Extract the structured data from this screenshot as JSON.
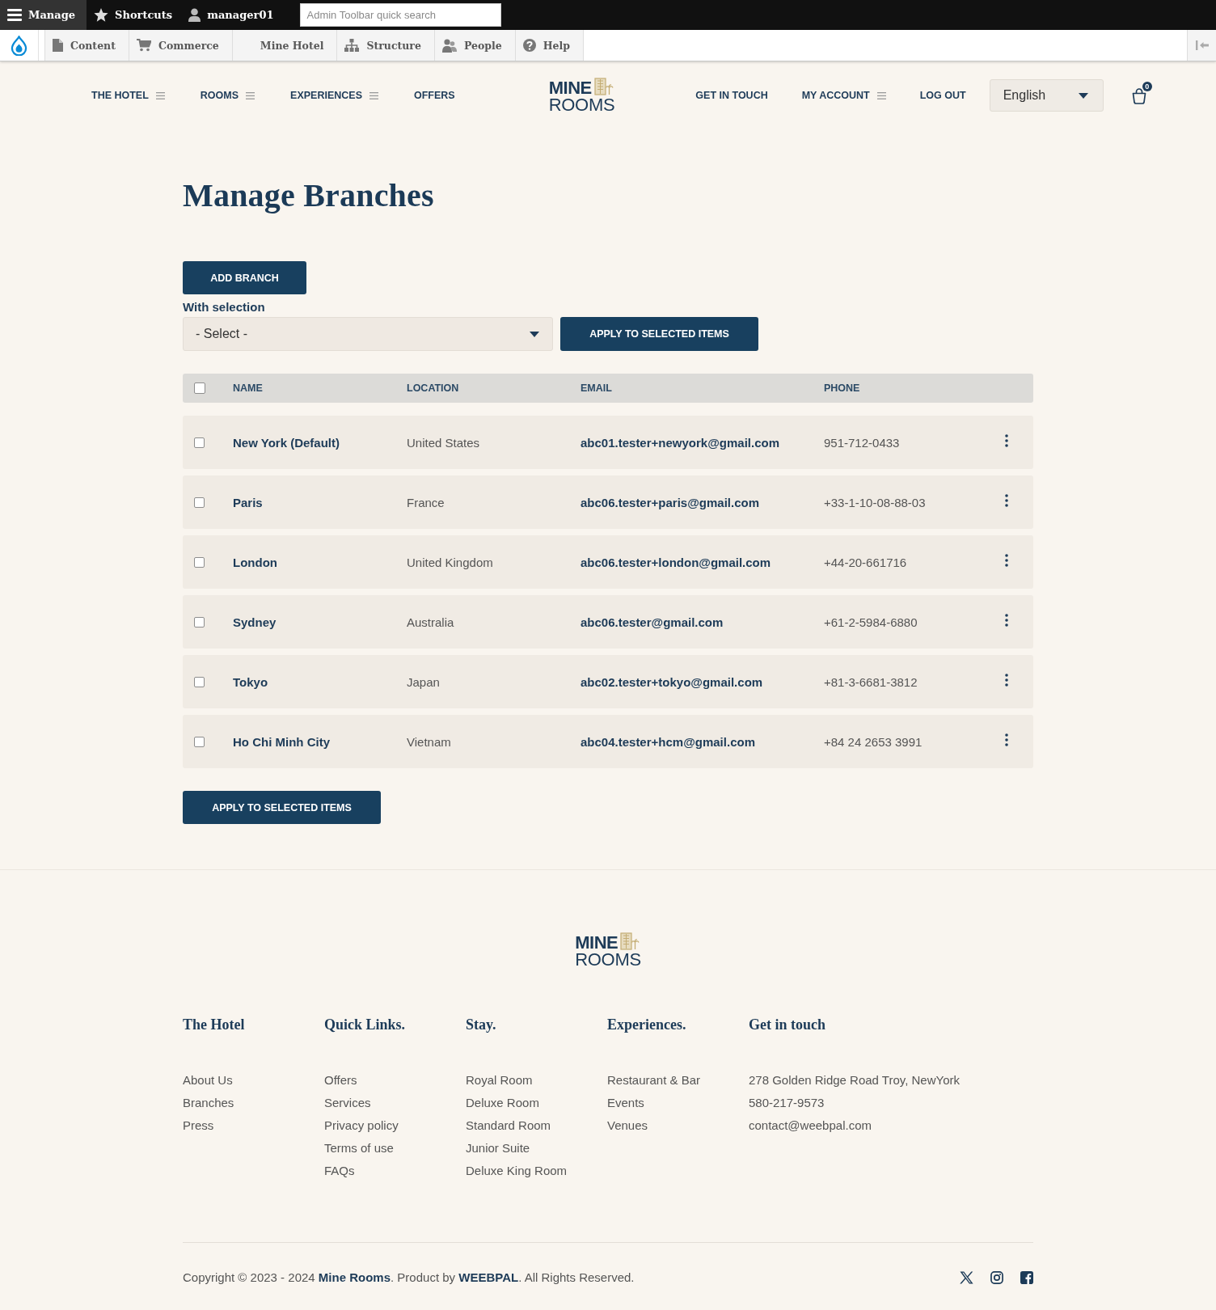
{
  "admin_bar": {
    "items": [
      {
        "label": "Manage",
        "selected": true
      },
      {
        "label": "Shortcuts",
        "selected": false
      },
      {
        "label": "manager01",
        "selected": false
      }
    ],
    "search": {
      "placeholder": "Admin Toolbar quick search"
    }
  },
  "admin_menu": {
    "items": [
      {
        "label": "Content"
      },
      {
        "label": "Commerce"
      },
      {
        "label": "Mine Hotel"
      },
      {
        "label": "Structure"
      },
      {
        "label": "People"
      },
      {
        "label": "Help"
      }
    ]
  },
  "header": {
    "nav_left": [
      {
        "label": "THE HOTEL",
        "submenu": true
      },
      {
        "label": "ROOMS",
        "submenu": true
      },
      {
        "label": "EXPERIENCES",
        "submenu": true
      },
      {
        "label": "OFFERS",
        "submenu": false
      }
    ],
    "logo": {
      "line_1": "MINE",
      "line_2": "ROOMS"
    },
    "nav_right": [
      {
        "label": "GET IN TOUCH",
        "submenu": false
      },
      {
        "label": "MY ACCOUNT",
        "submenu": true
      },
      {
        "label": "LOG OUT",
        "submenu": false
      }
    ],
    "language": {
      "value": "English"
    },
    "cart": {
      "count": "0"
    }
  },
  "page": {
    "title": "Manage Branches",
    "add_button": "ADD BRANCH",
    "bulk": {
      "label": "With selection",
      "select_value": "- Select -",
      "apply_button": "APPLY TO SELECTED ITEMS"
    }
  },
  "table": {
    "select_all": {
      "checked": false
    },
    "columns": [
      "NAME",
      "LOCATION",
      "EMAIL",
      "PHONE"
    ],
    "rows": [
      {
        "name": "New York (Default)",
        "location": "United States",
        "email": "abc01.tester+newyork@gmail.com",
        "phone": "951-712-0433",
        "checked": false
      },
      {
        "name": "Paris",
        "location": "France",
        "email": "abc06.tester+paris@gmail.com",
        "phone": "+33-1-10-08-88-03",
        "checked": false
      },
      {
        "name": "London",
        "location": "United Kingdom",
        "email": "abc06.tester+london@gmail.com",
        "phone": "+44-20-661716",
        "checked": false
      },
      {
        "name": "Sydney",
        "location": "Australia",
        "email": "abc06.tester@gmail.com",
        "phone": "+61-2-5984-6880",
        "checked": false
      },
      {
        "name": "Tokyo",
        "location": "Japan",
        "email": "abc02.tester+tokyo@gmail.com",
        "phone": "+81-3-6681-3812",
        "checked": false
      },
      {
        "name": "Ho Chi Minh City",
        "location": "Vietnam",
        "email": "abc04.tester+hcm@gmail.com",
        "phone": "+84 24 2653 3991",
        "checked": false
      }
    ]
  },
  "bottom_apply_button": "APPLY TO SELECTED ITEMS",
  "footer": {
    "logo": {
      "line_1": "MINE",
      "line_2": "ROOMS"
    },
    "columns": [
      {
        "title": "The Hotel",
        "items": [
          "About Us",
          "Branches",
          "Press"
        ]
      },
      {
        "title": "Quick Links.",
        "items": [
          "Offers",
          "Services",
          "Privacy policy",
          "Terms of use",
          "FAQs"
        ]
      },
      {
        "title": "Stay.",
        "items": [
          "Royal Room",
          "Deluxe Room",
          "Standard Room",
          "Junior Suite",
          "Deluxe King Room"
        ]
      },
      {
        "title": "Experiences.",
        "items": [
          "Restaurant & Bar",
          "Events",
          "Venues"
        ]
      },
      {
        "title": "Get in touch",
        "items": [
          "278 Golden Ridge Road Troy, NewYork",
          "580-217-9573",
          "contact@weebpal.com"
        ]
      }
    ],
    "copyright": "Copyright © 2023 - 2024 **Mine Rooms**. Product by **WEEBPAL**. All Rights Reserved."
  }
}
